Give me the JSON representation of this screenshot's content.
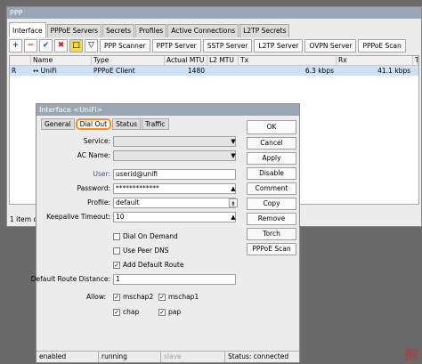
{
  "ppp_window": {
    "title": "PPP",
    "tabs": [
      "Interface",
      "PPPoE Servers",
      "Secrets",
      "Profiles",
      "Active Connections",
      "L2TP Secrets"
    ],
    "toolbar_icons": [
      "+",
      "−",
      "✔",
      "✖",
      "□",
      "▽"
    ],
    "toolbar_buttons": [
      "PPP Scanner",
      "PPTP Server",
      "SSTP Server",
      "L2TP Server",
      "OVPN Server",
      "PPPoE Scan"
    ],
    "columns": [
      "",
      "Name",
      "Type",
      "Actual MTU",
      "L2 MTU",
      "Tx",
      "Rx",
      "Tx Packet (p"
    ],
    "rows": [
      {
        "flag": "R",
        "name": "↔ UniFi",
        "type": "PPPoE Client",
        "mtu": "1480",
        "l2mtu": "",
        "tx": "6.3 kbps",
        "rx": "41.1 kbps",
        "txp": ""
      }
    ],
    "status": "1 item ou"
  },
  "dialog": {
    "title": "Interface <UniFi>",
    "tabs": [
      "General",
      "Dial Out",
      "Status",
      "Traffic"
    ],
    "fields": {
      "service_label": "Service:",
      "service_value": "",
      "ac_label": "AC Name:",
      "ac_value": "",
      "user_label": "User:",
      "user_value": "userid@unifi",
      "password_label": "Password:",
      "password_value": "*************",
      "profile_label": "Profile:",
      "profile_value": "default",
      "keepalive_label": "Keepalive Timeout:",
      "keepalive_value": "10",
      "distance_label": "Default Route Distance:",
      "distance_value": "1",
      "allow_label": "Allow:"
    },
    "checks": {
      "dial_on_demand": {
        "label": "Dial On Demand",
        "checked": false
      },
      "use_peer_dns": {
        "label": "Use Peer DNS",
        "checked": false
      },
      "add_default_route": {
        "label": "Add Default Route",
        "checked": true
      }
    },
    "allow": [
      {
        "label": "mschap2",
        "checked": true
      },
      {
        "label": "mschap1",
        "checked": true
      },
      {
        "label": "chap",
        "checked": true
      },
      {
        "label": "pap",
        "checked": true
      }
    ],
    "buttons": [
      "OK",
      "Cancel",
      "Apply",
      "Disable",
      "Comment",
      "Copy",
      "Remove",
      "Torch",
      "PPPoE Scan"
    ],
    "status": {
      "enabled": "enabled",
      "running": "running",
      "slave": "slave",
      "conn": "Status: connected"
    }
  },
  "watermark": "醉"
}
